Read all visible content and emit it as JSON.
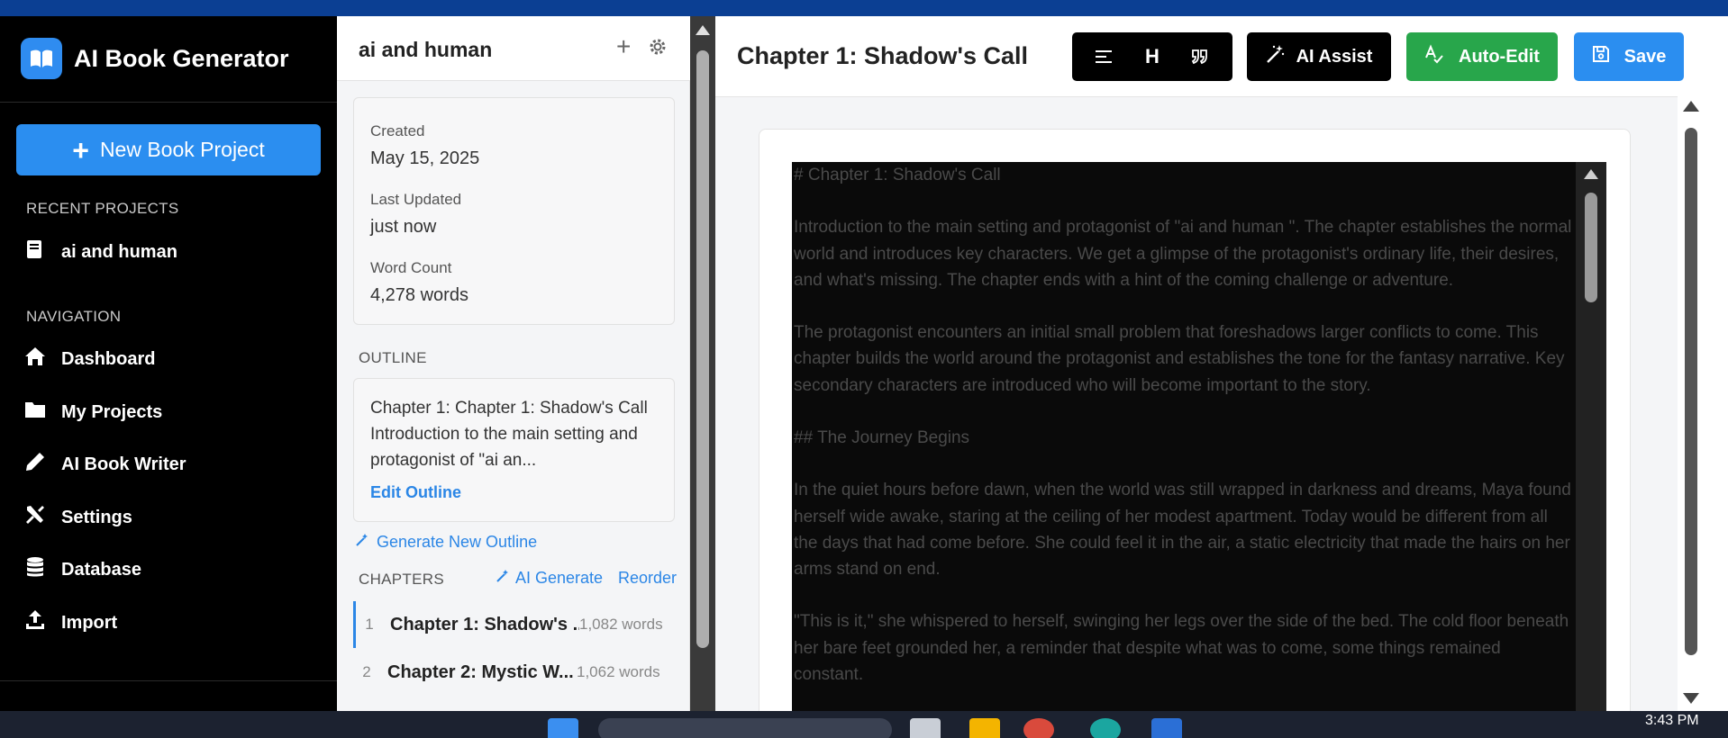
{
  "app": {
    "title": "AI Book Generator",
    "new_project_label": "New Book Project",
    "recent_section": "RECENT PROJECTS",
    "recent_projects": [
      {
        "label": "ai and human",
        "icon": "book-icon"
      }
    ],
    "nav_section": "NAVIGATION",
    "nav_items": [
      {
        "label": "Dashboard",
        "icon": "home-icon"
      },
      {
        "label": "My Projects",
        "icon": "folder-icon"
      },
      {
        "label": "AI Book Writer",
        "icon": "pencil-icon"
      },
      {
        "label": "Settings",
        "icon": "tools-icon"
      },
      {
        "label": "Database",
        "icon": "database-icon"
      },
      {
        "label": "Import",
        "icon": "upload-icon"
      }
    ]
  },
  "project": {
    "title": "ai and human",
    "created_label": "Created",
    "created_value": "May 15, 2025",
    "updated_label": "Last Updated",
    "updated_value": "just now",
    "wordcount_label": "Word Count",
    "wordcount_value": "4,278 words",
    "outline_title": "OUTLINE",
    "outline_text": "Chapter 1: Chapter 1: Shadow's Call Introduction to the main setting and protagonist of \"ai an...",
    "edit_outline_label": "Edit Outline",
    "generate_outline_label": "Generate New Outline",
    "chapters_title": "CHAPTERS",
    "ai_generate_label": "AI Generate",
    "reorder_label": "Reorder",
    "chapters": [
      {
        "num": "1",
        "title": "Chapter 1: Shadow's ...",
        "words": "1,082 words"
      },
      {
        "num": "2",
        "title": "Chapter 2: Mystic W...",
        "words": "1,062 words"
      }
    ]
  },
  "editor": {
    "chapter_title": "Chapter 1: Shadow's Call",
    "toolbar": {
      "heading_label": "H",
      "ai_assist_label": "AI Assist",
      "auto_edit_label": "Auto-Edit",
      "save_label": "Save"
    },
    "paragraphs": [
      "# Chapter 1: Shadow's Call",
      "Introduction to the main setting and protagonist of \"ai and human \". The chapter establishes the normal world and introduces key characters. We get a glimpse of the protagonist's ordinary life, their desires, and what's missing. The chapter ends with a hint of the coming challenge or adventure.",
      "The protagonist encounters an initial small problem that foreshadows larger conflicts to come. This chapter builds the world around the protagonist and establishes the tone for the fantasy narrative. Key secondary characters are introduced who will become important to the story.",
      "## The Journey Begins",
      "In the quiet hours before dawn, when the world was still wrapped in darkness and dreams, Maya found herself wide awake, staring at the ceiling of her modest apartment. Today would be different from all the days that had come before. She could feel it in the air, a static electricity that made the hairs on her arms stand on end.",
      "\"This is it,\" she whispered to herself, swinging her legs over the side of the bed. The cold floor beneath her bare feet grounded her, a reminder that despite what was to come, some things remained constant."
    ]
  },
  "taskbar": {
    "clock": "3:43 PM"
  },
  "colors": {
    "accent_blue": "#2b8ef0",
    "auto_edit_green": "#28a64b",
    "sidebar_bg": "#000000",
    "editor_text_bg": "#0a0a0a"
  }
}
